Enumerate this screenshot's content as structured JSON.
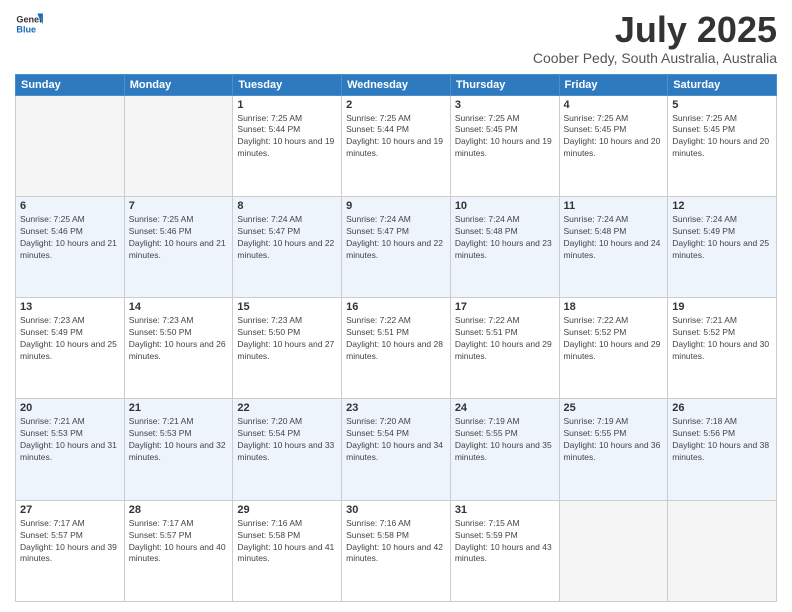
{
  "logo": {
    "line1": "General",
    "line2": "Blue"
  },
  "title": "July 2025",
  "subtitle": "Coober Pedy, South Australia, Australia",
  "days_of_week": [
    "Sunday",
    "Monday",
    "Tuesday",
    "Wednesday",
    "Thursday",
    "Friday",
    "Saturday"
  ],
  "weeks": [
    {
      "alt": false,
      "days": [
        {
          "num": "",
          "empty": true,
          "sunrise": "",
          "sunset": "",
          "daylight": ""
        },
        {
          "num": "",
          "empty": true,
          "sunrise": "",
          "sunset": "",
          "daylight": ""
        },
        {
          "num": "1",
          "empty": false,
          "sunrise": "Sunrise: 7:25 AM",
          "sunset": "Sunset: 5:44 PM",
          "daylight": "Daylight: 10 hours and 19 minutes."
        },
        {
          "num": "2",
          "empty": false,
          "sunrise": "Sunrise: 7:25 AM",
          "sunset": "Sunset: 5:44 PM",
          "daylight": "Daylight: 10 hours and 19 minutes."
        },
        {
          "num": "3",
          "empty": false,
          "sunrise": "Sunrise: 7:25 AM",
          "sunset": "Sunset: 5:45 PM",
          "daylight": "Daylight: 10 hours and 19 minutes."
        },
        {
          "num": "4",
          "empty": false,
          "sunrise": "Sunrise: 7:25 AM",
          "sunset": "Sunset: 5:45 PM",
          "daylight": "Daylight: 10 hours and 20 minutes."
        },
        {
          "num": "5",
          "empty": false,
          "sunrise": "Sunrise: 7:25 AM",
          "sunset": "Sunset: 5:45 PM",
          "daylight": "Daylight: 10 hours and 20 minutes."
        }
      ]
    },
    {
      "alt": true,
      "days": [
        {
          "num": "6",
          "empty": false,
          "sunrise": "Sunrise: 7:25 AM",
          "sunset": "Sunset: 5:46 PM",
          "daylight": "Daylight: 10 hours and 21 minutes."
        },
        {
          "num": "7",
          "empty": false,
          "sunrise": "Sunrise: 7:25 AM",
          "sunset": "Sunset: 5:46 PM",
          "daylight": "Daylight: 10 hours and 21 minutes."
        },
        {
          "num": "8",
          "empty": false,
          "sunrise": "Sunrise: 7:24 AM",
          "sunset": "Sunset: 5:47 PM",
          "daylight": "Daylight: 10 hours and 22 minutes."
        },
        {
          "num": "9",
          "empty": false,
          "sunrise": "Sunrise: 7:24 AM",
          "sunset": "Sunset: 5:47 PM",
          "daylight": "Daylight: 10 hours and 22 minutes."
        },
        {
          "num": "10",
          "empty": false,
          "sunrise": "Sunrise: 7:24 AM",
          "sunset": "Sunset: 5:48 PM",
          "daylight": "Daylight: 10 hours and 23 minutes."
        },
        {
          "num": "11",
          "empty": false,
          "sunrise": "Sunrise: 7:24 AM",
          "sunset": "Sunset: 5:48 PM",
          "daylight": "Daylight: 10 hours and 24 minutes."
        },
        {
          "num": "12",
          "empty": false,
          "sunrise": "Sunrise: 7:24 AM",
          "sunset": "Sunset: 5:49 PM",
          "daylight": "Daylight: 10 hours and 25 minutes."
        }
      ]
    },
    {
      "alt": false,
      "days": [
        {
          "num": "13",
          "empty": false,
          "sunrise": "Sunrise: 7:23 AM",
          "sunset": "Sunset: 5:49 PM",
          "daylight": "Daylight: 10 hours and 25 minutes."
        },
        {
          "num": "14",
          "empty": false,
          "sunrise": "Sunrise: 7:23 AM",
          "sunset": "Sunset: 5:50 PM",
          "daylight": "Daylight: 10 hours and 26 minutes."
        },
        {
          "num": "15",
          "empty": false,
          "sunrise": "Sunrise: 7:23 AM",
          "sunset": "Sunset: 5:50 PM",
          "daylight": "Daylight: 10 hours and 27 minutes."
        },
        {
          "num": "16",
          "empty": false,
          "sunrise": "Sunrise: 7:22 AM",
          "sunset": "Sunset: 5:51 PM",
          "daylight": "Daylight: 10 hours and 28 minutes."
        },
        {
          "num": "17",
          "empty": false,
          "sunrise": "Sunrise: 7:22 AM",
          "sunset": "Sunset: 5:51 PM",
          "daylight": "Daylight: 10 hours and 29 minutes."
        },
        {
          "num": "18",
          "empty": false,
          "sunrise": "Sunrise: 7:22 AM",
          "sunset": "Sunset: 5:52 PM",
          "daylight": "Daylight: 10 hours and 29 minutes."
        },
        {
          "num": "19",
          "empty": false,
          "sunrise": "Sunrise: 7:21 AM",
          "sunset": "Sunset: 5:52 PM",
          "daylight": "Daylight: 10 hours and 30 minutes."
        }
      ]
    },
    {
      "alt": true,
      "days": [
        {
          "num": "20",
          "empty": false,
          "sunrise": "Sunrise: 7:21 AM",
          "sunset": "Sunset: 5:53 PM",
          "daylight": "Daylight: 10 hours and 31 minutes."
        },
        {
          "num": "21",
          "empty": false,
          "sunrise": "Sunrise: 7:21 AM",
          "sunset": "Sunset: 5:53 PM",
          "daylight": "Daylight: 10 hours and 32 minutes."
        },
        {
          "num": "22",
          "empty": false,
          "sunrise": "Sunrise: 7:20 AM",
          "sunset": "Sunset: 5:54 PM",
          "daylight": "Daylight: 10 hours and 33 minutes."
        },
        {
          "num": "23",
          "empty": false,
          "sunrise": "Sunrise: 7:20 AM",
          "sunset": "Sunset: 5:54 PM",
          "daylight": "Daylight: 10 hours and 34 minutes."
        },
        {
          "num": "24",
          "empty": false,
          "sunrise": "Sunrise: 7:19 AM",
          "sunset": "Sunset: 5:55 PM",
          "daylight": "Daylight: 10 hours and 35 minutes."
        },
        {
          "num": "25",
          "empty": false,
          "sunrise": "Sunrise: 7:19 AM",
          "sunset": "Sunset: 5:55 PM",
          "daylight": "Daylight: 10 hours and 36 minutes."
        },
        {
          "num": "26",
          "empty": false,
          "sunrise": "Sunrise: 7:18 AM",
          "sunset": "Sunset: 5:56 PM",
          "daylight": "Daylight: 10 hours and 38 minutes."
        }
      ]
    },
    {
      "alt": false,
      "days": [
        {
          "num": "27",
          "empty": false,
          "sunrise": "Sunrise: 7:17 AM",
          "sunset": "Sunset: 5:57 PM",
          "daylight": "Daylight: 10 hours and 39 minutes."
        },
        {
          "num": "28",
          "empty": false,
          "sunrise": "Sunrise: 7:17 AM",
          "sunset": "Sunset: 5:57 PM",
          "daylight": "Daylight: 10 hours and 40 minutes."
        },
        {
          "num": "29",
          "empty": false,
          "sunrise": "Sunrise: 7:16 AM",
          "sunset": "Sunset: 5:58 PM",
          "daylight": "Daylight: 10 hours and 41 minutes."
        },
        {
          "num": "30",
          "empty": false,
          "sunrise": "Sunrise: 7:16 AM",
          "sunset": "Sunset: 5:58 PM",
          "daylight": "Daylight: 10 hours and 42 minutes."
        },
        {
          "num": "31",
          "empty": false,
          "sunrise": "Sunrise: 7:15 AM",
          "sunset": "Sunset: 5:59 PM",
          "daylight": "Daylight: 10 hours and 43 minutes."
        },
        {
          "num": "",
          "empty": true,
          "sunrise": "",
          "sunset": "",
          "daylight": ""
        },
        {
          "num": "",
          "empty": true,
          "sunrise": "",
          "sunset": "",
          "daylight": ""
        }
      ]
    }
  ]
}
